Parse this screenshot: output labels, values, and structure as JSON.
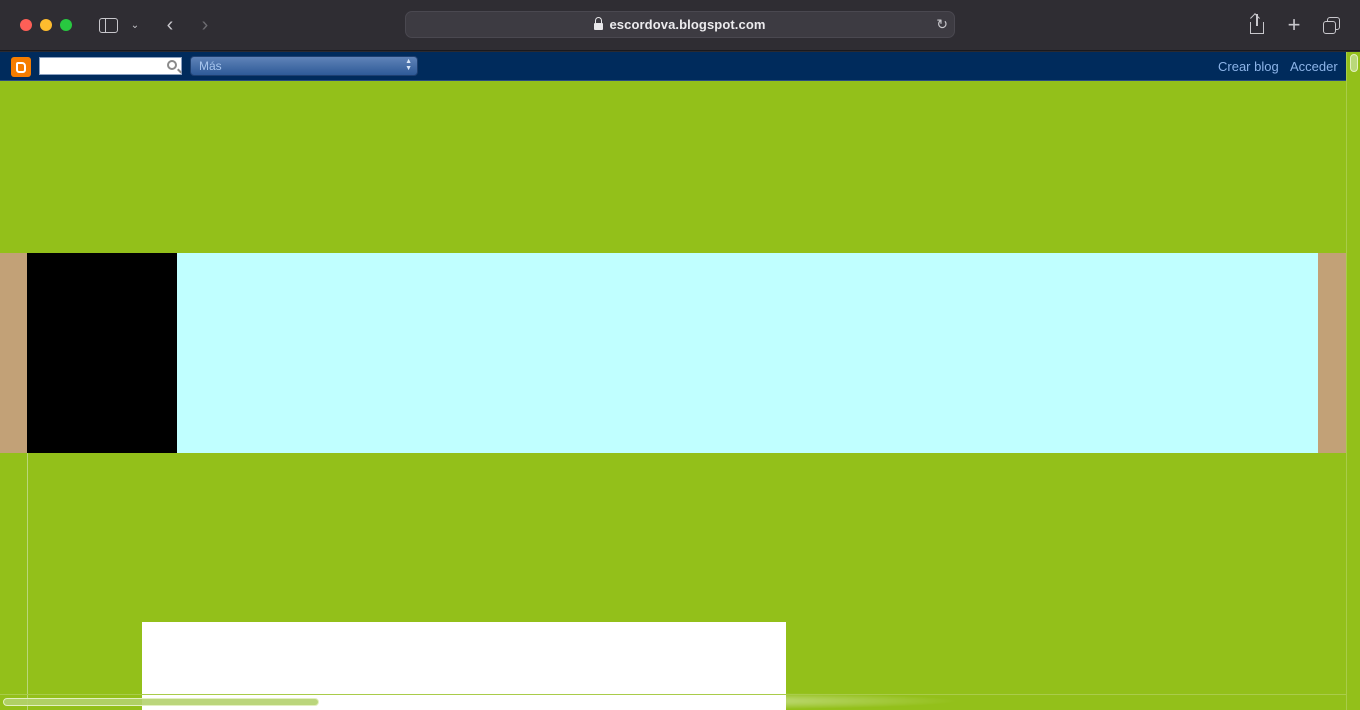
{
  "browser": {
    "url": "escordova.blogspot.com"
  },
  "navbar": {
    "search_placeholder": "",
    "more_label": "Más",
    "create_blog": "Crear blog",
    "login": "Acceder"
  },
  "colors": {
    "page_background": "#93c01a",
    "navbar_background": "#002b5c",
    "header_band": "#c2a177",
    "header_left": "#000000",
    "header_main": "#c0ffff",
    "content_box": "#ffffff"
  },
  "icons": {
    "sidebar": "sidebar-icon",
    "back": "chevron-left-icon",
    "forward": "chevron-right-icon",
    "lock": "lock-icon",
    "reload": "reload-icon",
    "share": "share-icon",
    "new_tab": "plus-icon",
    "tabs": "tabs-overview-icon",
    "blogger": "blogger-logo-icon",
    "search": "search-icon"
  }
}
